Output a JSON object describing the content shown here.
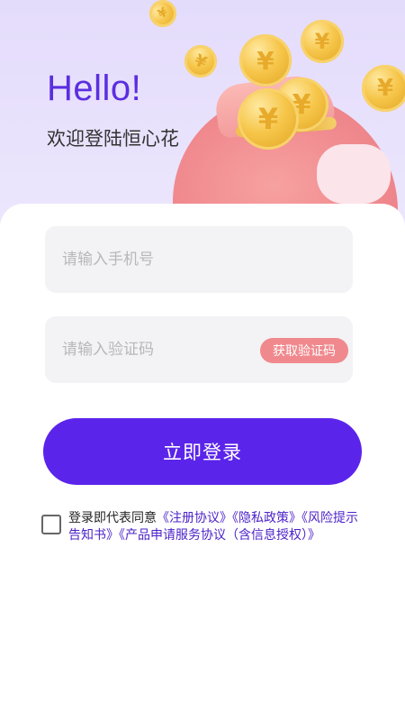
{
  "header": {
    "hello": "Hello!",
    "welcome": "欢迎登陆恒心花"
  },
  "decor": {
    "coin_symbol": "¥"
  },
  "form": {
    "phone_placeholder": "请输入手机号",
    "code_placeholder": "请输入验证码",
    "get_code_label": "获取验证码",
    "login_label": "立即登录"
  },
  "agreement": {
    "checked": false,
    "prefix": "登录即代表同意",
    "links": [
      "《注册协议》",
      "《隐私政策》",
      "《风险提示告知书》",
      "《产品申请服务协议（含信息授权）》"
    ]
  },
  "colors": {
    "accent": "#5b24ea",
    "hello": "#5a2ee0",
    "code_button": "#f0898e",
    "link": "#4c23c8",
    "hero_bg": "#e4dcfb"
  }
}
